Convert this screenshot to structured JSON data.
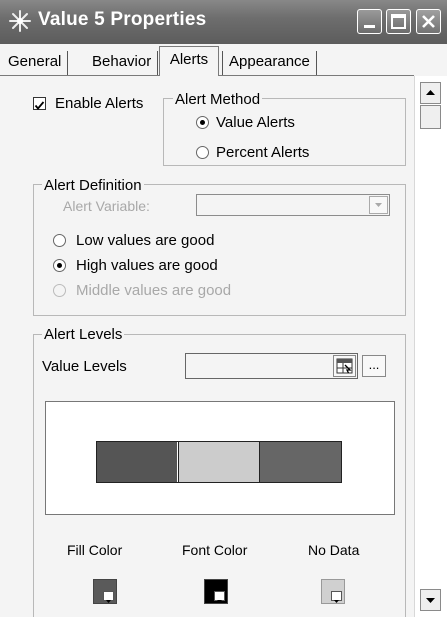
{
  "window": {
    "title": "Value 5 Properties"
  },
  "tabs": [
    {
      "label": "General"
    },
    {
      "label": "Behavior"
    },
    {
      "label": "Alerts",
      "active": true
    },
    {
      "label": "Appearance"
    }
  ],
  "enable_alerts": {
    "label": "Enable Alerts",
    "checked": true
  },
  "alert_method": {
    "title": "Alert Method",
    "options": [
      {
        "label": "Value Alerts",
        "selected": true
      },
      {
        "label": "Percent Alerts",
        "selected": false
      }
    ]
  },
  "alert_definition": {
    "title": "Alert Definition",
    "variable_label": "Alert Variable:",
    "variable_value": "",
    "options": [
      {
        "label": "Low values are good",
        "selected": false,
        "enabled": true
      },
      {
        "label": "High values are good",
        "selected": true,
        "enabled": true
      },
      {
        "label": "Middle values are good",
        "selected": false,
        "enabled": false
      }
    ]
  },
  "alert_levels": {
    "title": "Alert Levels",
    "value_levels_label": "Value Levels",
    "value_levels_value": "",
    "browse_label": "...",
    "swatches": [
      "#555555",
      "#cccccc",
      "#666666"
    ],
    "fill_color": {
      "label": "Fill Color",
      "color": "#5a5a5a"
    },
    "font_color": {
      "label": "Font Color",
      "color": "#000000"
    },
    "no_data": {
      "label": "No Data",
      "color": "#d0d0d0"
    }
  }
}
